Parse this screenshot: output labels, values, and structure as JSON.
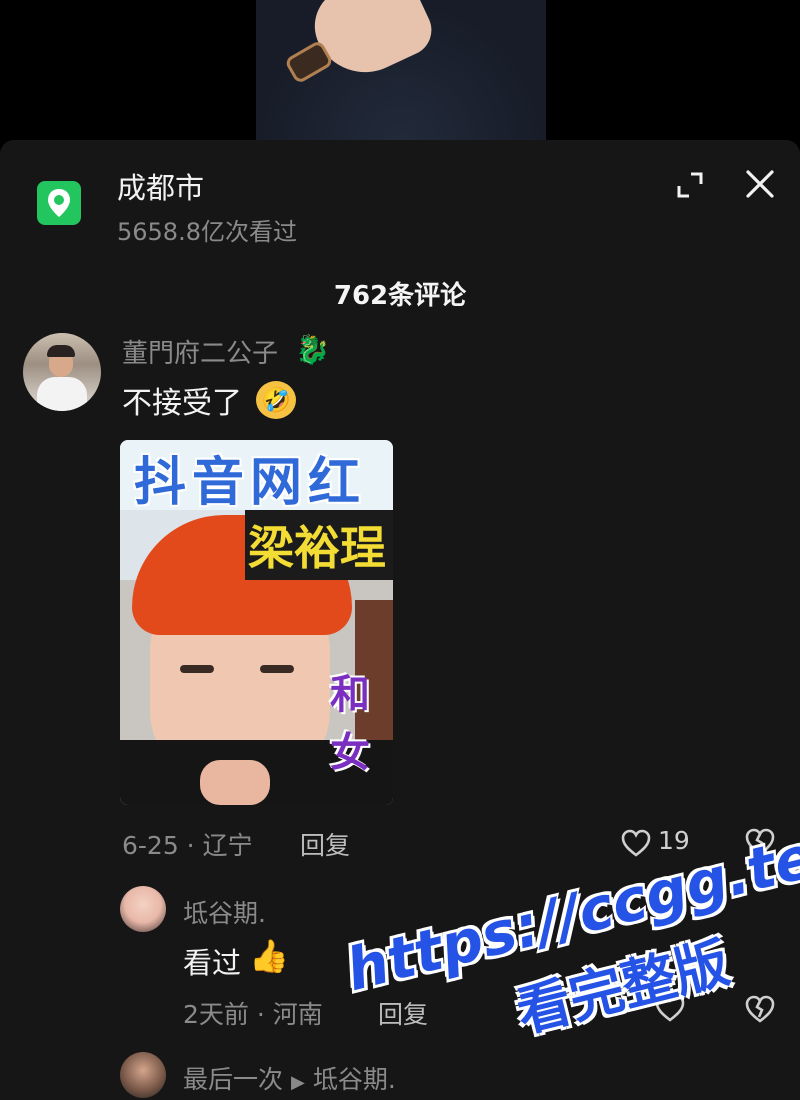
{
  "location": {
    "title": "成都市",
    "views": "5658.8亿次看过",
    "icon": "location-pin-icon",
    "icon_color": "#22c55e"
  },
  "header": {
    "expand_icon": "expand-icon",
    "close_icon": "close-icon",
    "comment_count": "762条评论"
  },
  "comments": [
    {
      "username": "董門府二公子",
      "badge": "🐉",
      "text": "不接受了",
      "emoji": "🤣",
      "meta": "6-25 · 辽宁",
      "reply_label": "回复",
      "likes": "19",
      "image_text": {
        "line1": "抖音网红",
        "line2": "梁裕珵",
        "line3": "和女"
      },
      "replies": [
        {
          "username": "坻谷期.",
          "text": "看过",
          "emoji": "👍",
          "meta": "2天前 · 河南",
          "reply_label": "回复"
        },
        {
          "username": "最后一次",
          "reply_to": "坻谷期."
        }
      ]
    }
  ],
  "watermark": {
    "line1": "https://ccgg.tech",
    "line2": "看完整版"
  }
}
